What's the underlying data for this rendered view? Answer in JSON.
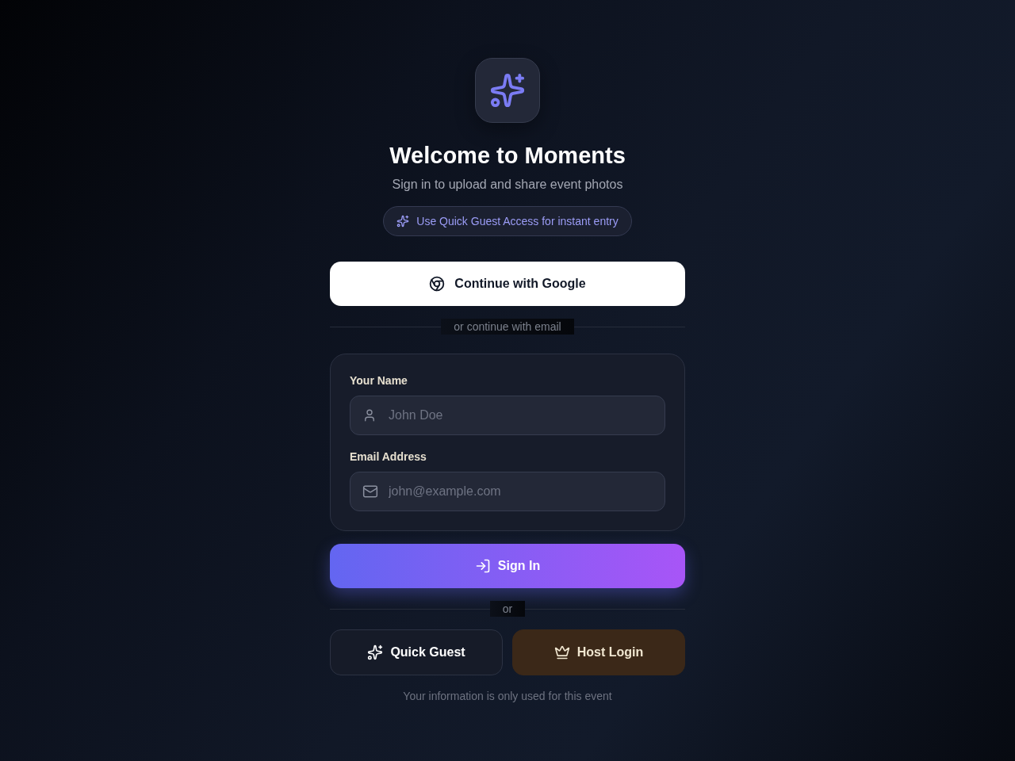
{
  "header": {
    "title": "Welcome to Moments",
    "subtitle": "Sign in to upload and share event photos",
    "hint": "Use Quick Guest Access for instant entry"
  },
  "google_button": {
    "label": "Continue with Google"
  },
  "email_divider": "or continue with email",
  "form": {
    "fields": [
      {
        "kind": "name",
        "label": "Your Name",
        "placeholder": "John Doe"
      },
      {
        "kind": "email",
        "label": "Email Address",
        "placeholder": "john@example.com"
      }
    ]
  },
  "sign_in_button": {
    "label": "Sign In"
  },
  "or_divider": "or",
  "alt_buttons": [
    {
      "kind": "guest",
      "label": "Quick Guest"
    },
    {
      "kind": "host",
      "label": "Host Login"
    }
  ],
  "footer": "Your information is only used for this event"
}
